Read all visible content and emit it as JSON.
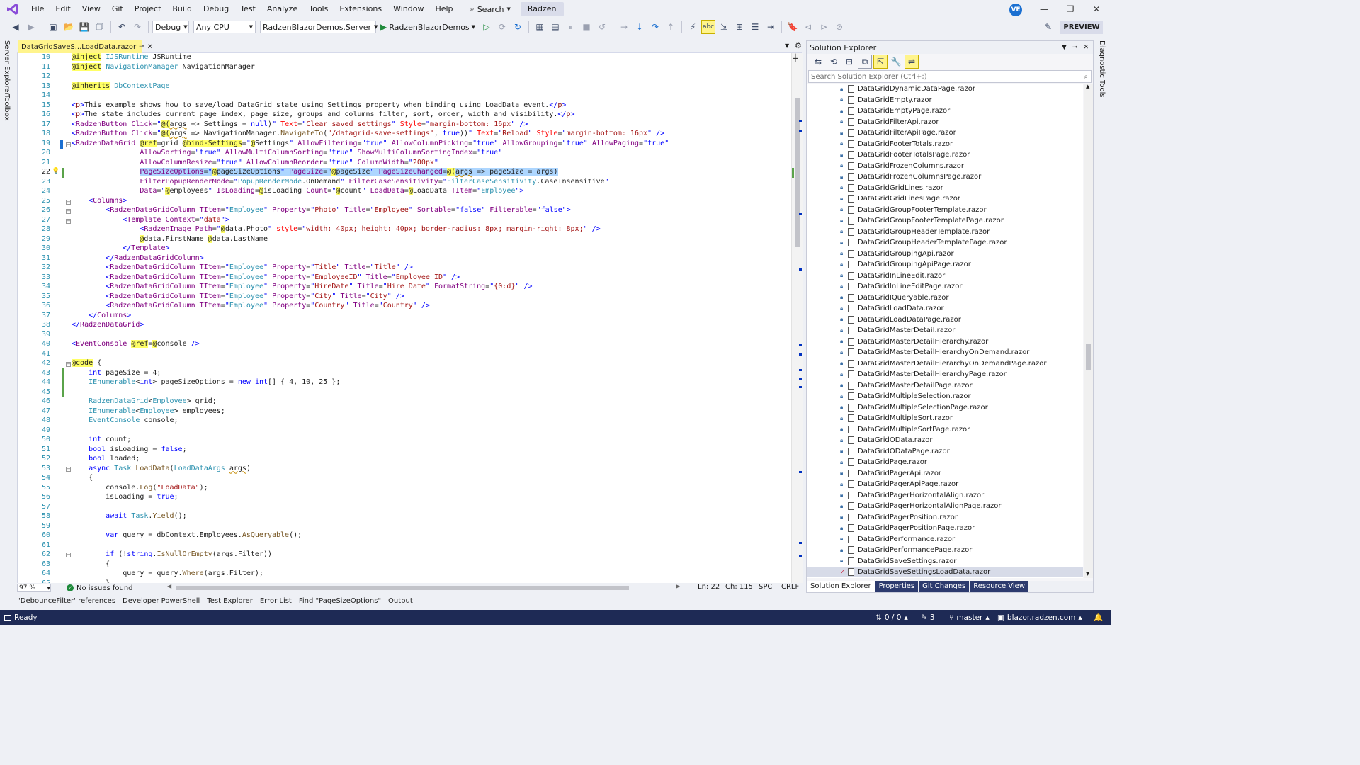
{
  "menu": {
    "items": [
      "File",
      "Edit",
      "View",
      "Git",
      "Project",
      "Build",
      "Debug",
      "Test",
      "Analyze",
      "Tools",
      "Extensions",
      "Window",
      "Help"
    ],
    "search_label": "Search",
    "app_badge": "Radzen",
    "avatar_initials": "VE"
  },
  "toolbar": {
    "config": "Debug",
    "platform": "Any CPU",
    "startup_project": "RadzenBlazorDemos.Server",
    "run_label": "RadzenBlazorDemos",
    "preview_label": "PREVIEW"
  },
  "left_rail": [
    "Server Explorer",
    "Toolbox"
  ],
  "right_rail": [
    "Diagnostic Tools"
  ],
  "editor": {
    "tab_title": "DataGridSaveS...LoadData.razor",
    "current_line": 22,
    "line_numbers": [
      10,
      11,
      12,
      13,
      14,
      15,
      16,
      17,
      18,
      19,
      20,
      21,
      22,
      23,
      24,
      25,
      26,
      27,
      28,
      29,
      30,
      31,
      32,
      33,
      34,
      35,
      36,
      37,
      38,
      39,
      40,
      41,
      42,
      43,
      44,
      45,
      46,
      47,
      48,
      49,
      50,
      51,
      52,
      53,
      54,
      55,
      56,
      57,
      58,
      59,
      60,
      61,
      62,
      63,
      64,
      65
    ],
    "zoom": "97 %",
    "issues": "No issues found",
    "ln": "Ln: 22",
    "ch": "Ch: 115",
    "spc": "SPC",
    "eol": "CRLF"
  },
  "solution_explorer": {
    "title": "Solution Explorer",
    "search_placeholder": "Search Solution Explorer (Ctrl+;)",
    "files": [
      "DataGridDynamicDataPage.razor",
      "DataGridEmpty.razor",
      "DataGridEmptyPage.razor",
      "DataGridFilterApi.razor",
      "DataGridFilterApiPage.razor",
      "DataGridFooterTotals.razor",
      "DataGridFooterTotalsPage.razor",
      "DataGridFrozenColumns.razor",
      "DataGridFrozenColumnsPage.razor",
      "DataGridGridLines.razor",
      "DataGridGridLinesPage.razor",
      "DataGridGroupFooterTemplate.razor",
      "DataGridGroupFooterTemplatePage.razor",
      "DataGridGroupHeaderTemplate.razor",
      "DataGridGroupHeaderTemplatePage.razor",
      "DataGridGroupingApi.razor",
      "DataGridGroupingApiPage.razor",
      "DataGridInLineEdit.razor",
      "DataGridInLineEditPage.razor",
      "DataGridIQueryable.razor",
      "DataGridLoadData.razor",
      "DataGridLoadDataPage.razor",
      "DataGridMasterDetail.razor",
      "DataGridMasterDetailHierarchy.razor",
      "DataGridMasterDetailHierarchyOnDemand.razor",
      "DataGridMasterDetailHierarchyOnDemandPage.razor",
      "DataGridMasterDetailHierarchyPage.razor",
      "DataGridMasterDetailPage.razor",
      "DataGridMultipleSelection.razor",
      "DataGridMultipleSelectionPage.razor",
      "DataGridMultipleSort.razor",
      "DataGridMultipleSortPage.razor",
      "DataGridOData.razor",
      "DataGridODataPage.razor",
      "DataGridPage.razor",
      "DataGridPagerApi.razor",
      "DataGridPagerApiPage.razor",
      "DataGridPagerHorizontalAlign.razor",
      "DataGridPagerHorizontalAlignPage.razor",
      "DataGridPagerPosition.razor",
      "DataGridPagerPositionPage.razor",
      "DataGridPerformance.razor",
      "DataGridPerformancePage.razor",
      "DataGridSaveSettings.razor",
      "DataGridSaveSettingsLoadData.razor"
    ],
    "selected_index": 44,
    "bottom_tabs": [
      "Solution Explorer",
      "Properties",
      "Git Changes",
      "Resource View"
    ]
  },
  "tool_tabs": [
    "'DebounceFilter' references",
    "Developer PowerShell",
    "Test Explorer",
    "Error List",
    "Find \"PageSizeOptions\"",
    "Output"
  ],
  "status": {
    "ready": "Ready",
    "errors": "0 / 0",
    "pencil_count": "3",
    "branch": "master",
    "repo": "blazor.radzen.com"
  }
}
